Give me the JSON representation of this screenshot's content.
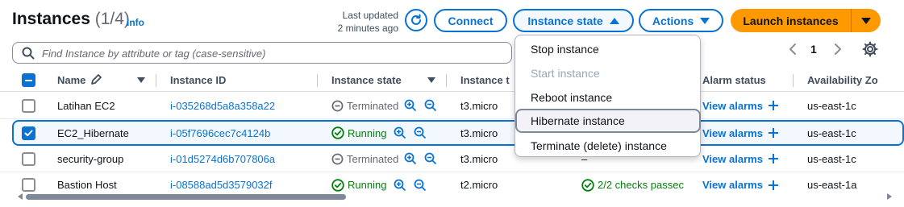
{
  "header": {
    "title": "Instances",
    "count": "(1/4)",
    "info": "Info",
    "last_updated_line1": "Last updated",
    "last_updated_line2": "2 minutes ago",
    "connect_label": "Connect",
    "instance_state_label": "Instance state",
    "actions_label": "Actions",
    "launch_label": "Launch instances"
  },
  "search": {
    "placeholder": "Find Instance by attribute or tag (case-sensitive)",
    "value": ""
  },
  "pagination": {
    "current_page": "1"
  },
  "table": {
    "columns": {
      "name": "Name",
      "instance_id": "Instance ID",
      "instance_state": "Instance state",
      "instance_type": "Instance t",
      "alarm_status": "Alarm status",
      "availability_zone": "Availability Zo"
    },
    "rows": [
      {
        "name": "Latihan EC2",
        "instance_id": "i-035268d5a8a358a22",
        "state": "Terminated",
        "type": "t3.micro",
        "status_check": "",
        "alarm": "View alarms",
        "zone": "us-east-1c",
        "selected": false
      },
      {
        "name": "EC2_Hibernate",
        "instance_id": "i-05f7696cec7c4124b",
        "state": "Running",
        "type": "t3.micro",
        "status_check": "",
        "alarm": "View alarms",
        "zone": "us-east-1c",
        "selected": true
      },
      {
        "name": "security-group",
        "instance_id": "i-01d5274d6b707806a",
        "state": "Terminated",
        "type": "t3.micro",
        "status_check": "–",
        "alarm": "View alarms",
        "zone": "us-east-1c",
        "selected": false
      },
      {
        "name": "Bastion Host",
        "instance_id": "i-08588ad5d3579032f",
        "state": "Running",
        "type": "t2.micro",
        "status_check": "2/2 checks passec",
        "alarm": "View alarms",
        "zone": "us-east-1a",
        "selected": false
      }
    ]
  },
  "dropdown": {
    "items": [
      {
        "label": "Stop instance",
        "disabled": false
      },
      {
        "label": "Start instance",
        "disabled": true
      },
      {
        "label": "Reboot instance",
        "disabled": false
      },
      {
        "label": "Hibernate instance",
        "disabled": false,
        "hovered": true
      },
      {
        "label": "Terminate (delete) instance",
        "disabled": false
      }
    ]
  },
  "colors": {
    "accent": "#0972d3",
    "primary_button": "#ff9900",
    "running": "#037f0c",
    "terminated": "#656871"
  }
}
